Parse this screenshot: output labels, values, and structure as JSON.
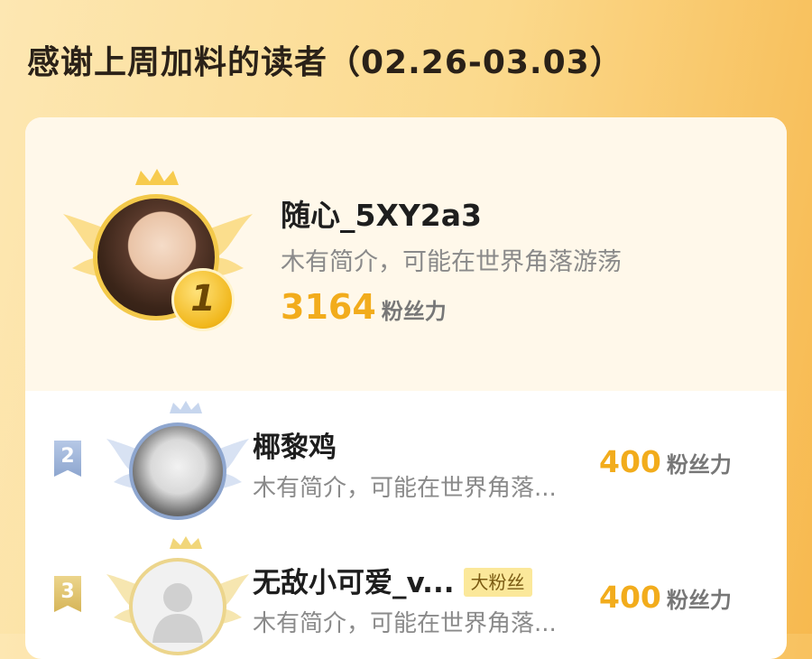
{
  "header": {
    "title": "感谢上周加料的读者（02.26-03.03）"
  },
  "colors": {
    "accent": "#f2ac1c",
    "gold": "#f3c94a",
    "silver": "#9fb4d6",
    "bronze": "#e3c36a"
  },
  "leaderboard": {
    "first": {
      "rank": "1",
      "name": "随心_5XY2a3",
      "bio": "木有简介，可能在世界角落游荡",
      "score": "3164",
      "score_unit": "粉丝力"
    },
    "rows": [
      {
        "rank": "2",
        "name": "椰黎鸡",
        "bio": "木有简介，可能在世界角落...",
        "score": "400",
        "score_unit": "粉丝力"
      },
      {
        "rank": "3",
        "name": "无敌小可爱_v...",
        "badge": "大粉丝",
        "bio": "木有简介，可能在世界角落...",
        "score": "400",
        "score_unit": "粉丝力"
      }
    ]
  }
}
